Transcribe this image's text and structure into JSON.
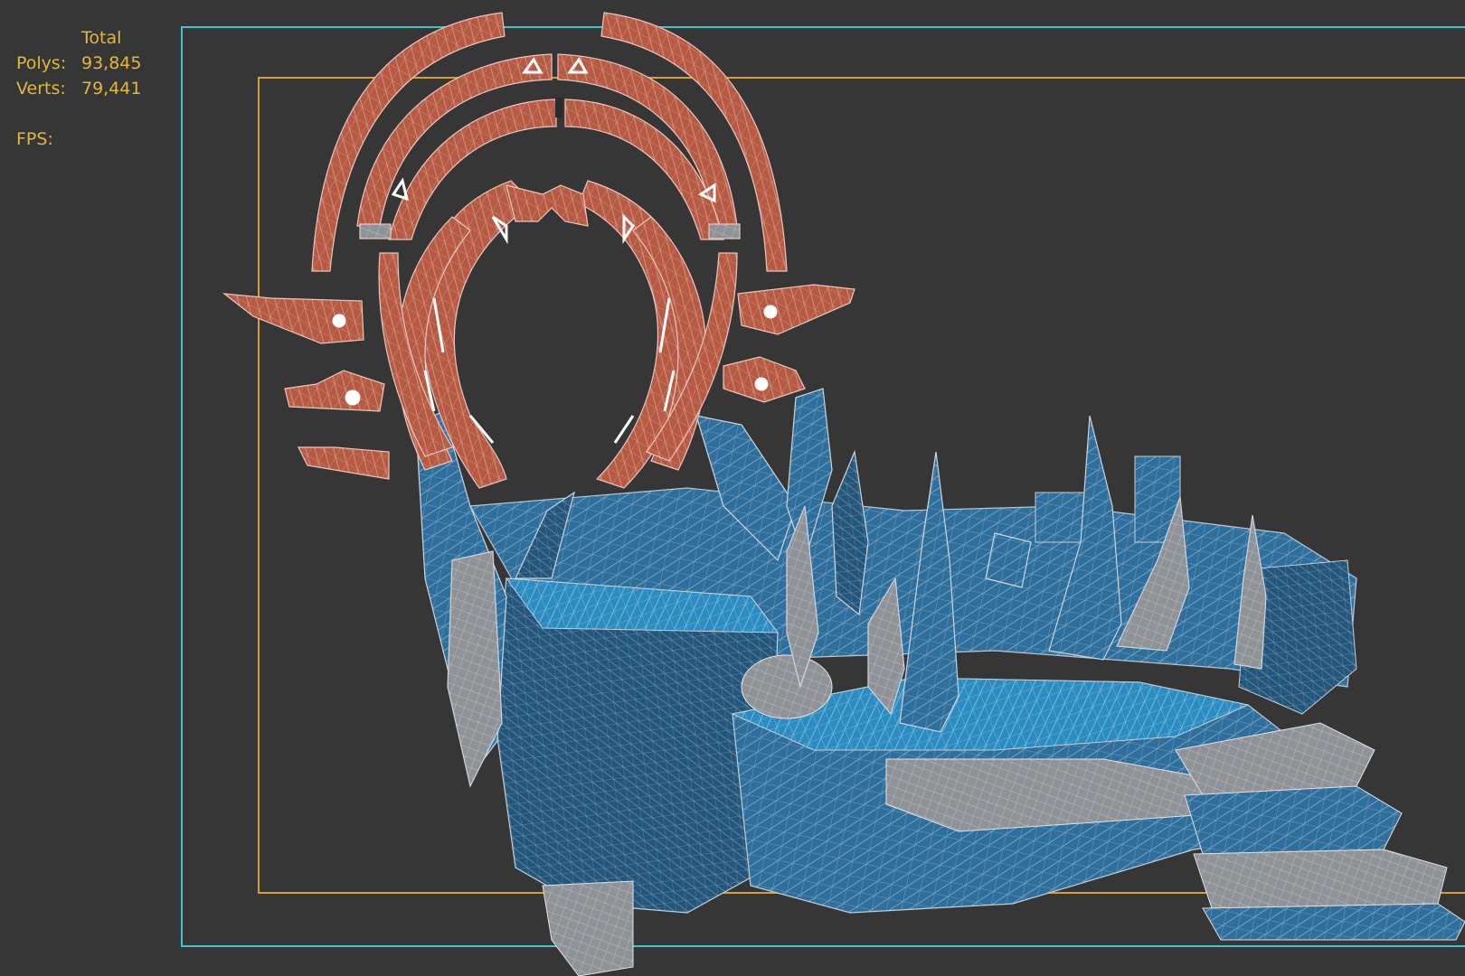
{
  "viewport": {
    "stats": {
      "header": "Total",
      "polys_label": "Polys:",
      "polys_value": "93,845",
      "verts_label": "Verts:",
      "verts_value": "79,441",
      "fps_label": "FPS:"
    },
    "colors": {
      "background": "#363636",
      "stats_text": "#e2b73b",
      "safe_frame_outer": "#3cc8c8",
      "safe_frame_inner": "#d8a02a",
      "portal_rock": "#b4543e",
      "ice_platform": "#2e6f9c",
      "wire": "#c8c8c8"
    }
  }
}
